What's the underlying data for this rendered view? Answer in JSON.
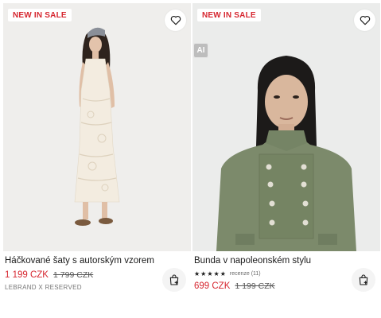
{
  "products": [
    {
      "badge": "NEW IN SALE",
      "title": "Háčkované šaty s autorským vzorem",
      "price": "1 199 CZK",
      "old_price": "1 799 CZK",
      "brand": "LEBRAND X RESERVED",
      "image": "woman in cream crochet maxi dress with headscarf and sandals"
    },
    {
      "badge": "NEW IN SALE",
      "ai_label": "AI",
      "title": "Bunda v napoleonském stylu",
      "price": "699 CZK",
      "old_price": "1 199 CZK",
      "rating_stars": "★★★★★",
      "rating_text": "recenze (11)",
      "image": "woman in khaki military-style jacket with gold buttons"
    }
  ],
  "icons": {
    "wishlist": "heart-icon",
    "cart": "add-to-cart-icon"
  },
  "colors": {
    "sale_red": "#d6262f",
    "text": "#1a1a1a"
  }
}
